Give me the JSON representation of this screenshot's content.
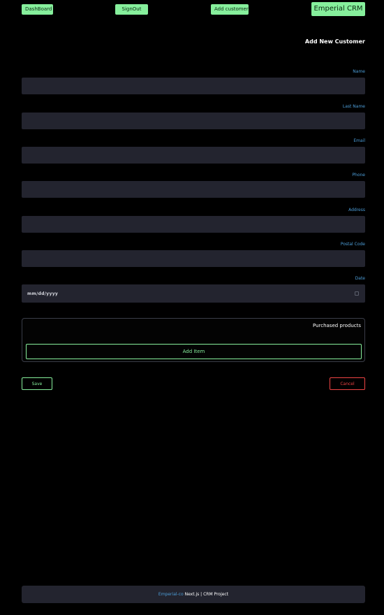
{
  "nav": {
    "dashboard": "DashBoard",
    "signout": "SignOut",
    "add_customer": "Add customer",
    "brand": "Emperial CRM"
  },
  "page": {
    "title": "Add New Customer"
  },
  "form": {
    "fields": [
      {
        "label": "Name",
        "value": ""
      },
      {
        "label": "Last Name",
        "value": ""
      },
      {
        "label": "Email",
        "value": ""
      },
      {
        "label": "Phone",
        "value": ""
      },
      {
        "label": "Address",
        "value": ""
      },
      {
        "label": "Postal Code",
        "value": ""
      }
    ],
    "date": {
      "label": "Date",
      "placeholder": "mm/dd/yyyy"
    }
  },
  "products": {
    "title": "Purchased products",
    "add_item": "Add Item"
  },
  "actions": {
    "save": "Save",
    "cancel": "Cancel"
  },
  "footer": {
    "brand": "Emperial-co",
    "text": "Next.js | CRM Project"
  },
  "colors": {
    "background": "#000000",
    "accent": "#86ef9c",
    "label": "#4d9ed9",
    "input_bg": "#23242f",
    "danger": "#ef4444"
  }
}
